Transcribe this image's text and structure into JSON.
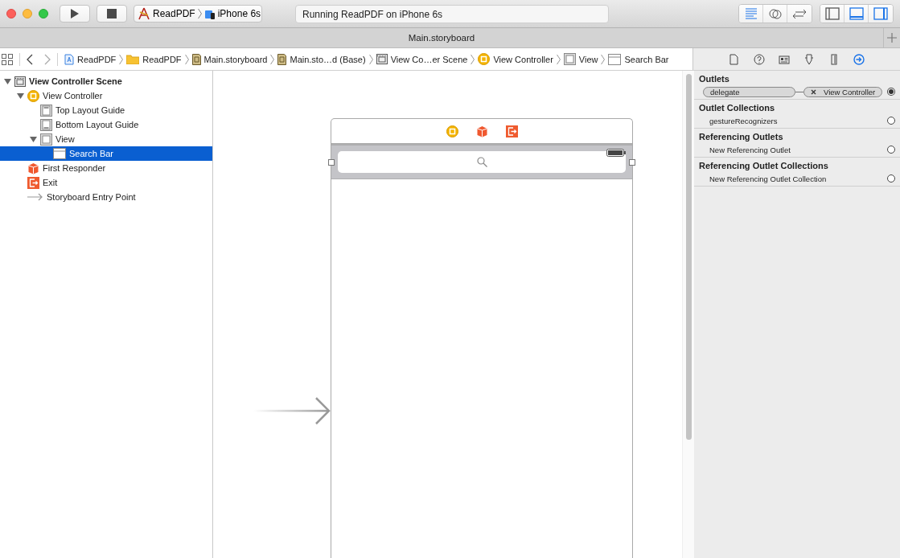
{
  "toolbar": {
    "scheme": {
      "project": "ReadPDF",
      "device": "iPhone 6s"
    },
    "activity": "Running ReadPDF on iPhone 6s",
    "editor_modes": [
      {
        "kind": "standard",
        "selected": true
      },
      {
        "kind": "assistant",
        "selected": false
      },
      {
        "kind": "version",
        "selected": false
      }
    ],
    "panels": [
      {
        "kind": "navigator",
        "selected": false
      },
      {
        "kind": "debug",
        "selected": true
      },
      {
        "kind": "utilities",
        "selected": true
      }
    ]
  },
  "tab": {
    "title": "Main.storyboard"
  },
  "jump_bar": [
    {
      "kind": "project",
      "label": "ReadPDF"
    },
    {
      "kind": "folder",
      "label": "ReadPDF"
    },
    {
      "kind": "storyboard",
      "label": "Main.storyboard"
    },
    {
      "kind": "storyboard",
      "label": "Main.sto…d (Base)"
    },
    {
      "kind": "scene",
      "label": "View Co…er Scene"
    },
    {
      "kind": "controller",
      "label": "View Controller"
    },
    {
      "kind": "view",
      "label": "View"
    },
    {
      "kind": "searchbar",
      "label": "Search Bar"
    }
  ],
  "outline": [
    {
      "kind": "scene",
      "label": "View Controller Scene",
      "expanded": true,
      "selected": false,
      "children": [
        {
          "kind": "controller",
          "label": "View Controller",
          "expanded": true,
          "selected": false,
          "children": [
            {
              "kind": "topguide",
              "label": "Top Layout Guide",
              "selected": false
            },
            {
              "kind": "bottomguide",
              "label": "Bottom Layout Guide",
              "selected": false
            },
            {
              "kind": "view",
              "label": "View",
              "expanded": true,
              "selected": false,
              "children": [
                {
                  "kind": "searchbar",
                  "label": "Search Bar",
                  "selected": true
                }
              ]
            }
          ]
        },
        {
          "kind": "responder",
          "label": "First Responder",
          "selected": false
        },
        {
          "kind": "exit",
          "label": "Exit",
          "selected": false
        },
        {
          "kind": "entry",
          "label": "Storyboard Entry Point",
          "selected": false
        }
      ]
    }
  ],
  "inspector_tabs": [
    {
      "kind": "file",
      "selected": false
    },
    {
      "kind": "help",
      "selected": false
    },
    {
      "kind": "identity",
      "selected": false
    },
    {
      "kind": "attributes",
      "selected": false
    },
    {
      "kind": "size",
      "selected": false
    },
    {
      "kind": "connections",
      "selected": true
    }
  ],
  "connections": [
    {
      "title": "Outlets",
      "items": [
        {
          "name": "delegate",
          "target": "View Controller",
          "connected": true
        }
      ]
    },
    {
      "title": "Outlet Collections",
      "items": [
        {
          "name": "gestureRecognizers",
          "connected": false
        }
      ]
    },
    {
      "title": "Referencing Outlets",
      "items": [
        {
          "name": "New Referencing Outlet",
          "connected": false
        }
      ]
    },
    {
      "title": "Referencing Outlet Collections",
      "items": [
        {
          "name": "New Referencing Outlet Collection",
          "connected": false
        }
      ]
    }
  ]
}
